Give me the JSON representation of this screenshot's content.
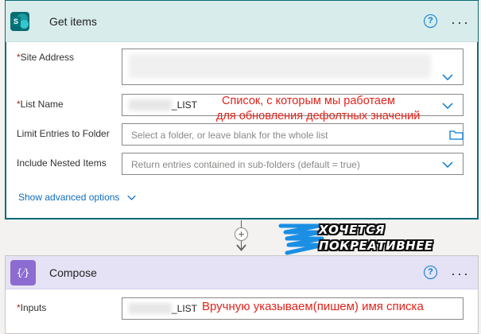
{
  "get_items": {
    "title": "Get items",
    "help": "?",
    "more": "···",
    "site_address_label": "Site Address",
    "list_name_label": "List Name",
    "list_name_suffix": "_LIST",
    "limit_folder_label": "Limit Entries to Folder",
    "limit_folder_placeholder": "Select a folder, or leave blank for the whole list",
    "nested_label": "Include Nested Items",
    "nested_placeholder": "Return entries contained in sub-folders (default = true)",
    "show_advanced": "Show advanced options",
    "required_mark": "*"
  },
  "annotations": {
    "list_line1": "Список, с которым мы работаем",
    "list_line2": "для обновления дефолтных значений",
    "inputs_note": "Вручную указываем(пишем) имя списка"
  },
  "connector": {
    "plus": "+"
  },
  "promo": {
    "line1": "ХОЧЕТСЯ",
    "line2": "ПОКРЕАТИВНЕЕ"
  },
  "compose": {
    "title": "Compose",
    "icon_glyph": "{⁄}",
    "help": "?",
    "more": "···",
    "inputs_label": "Inputs",
    "inputs_suffix": "_LIST",
    "required_mark": "*"
  },
  "colors": {
    "annotation": "#e0241b",
    "link": "#0f6cbd",
    "required": "#a4262c",
    "accent": "#0078d4"
  }
}
